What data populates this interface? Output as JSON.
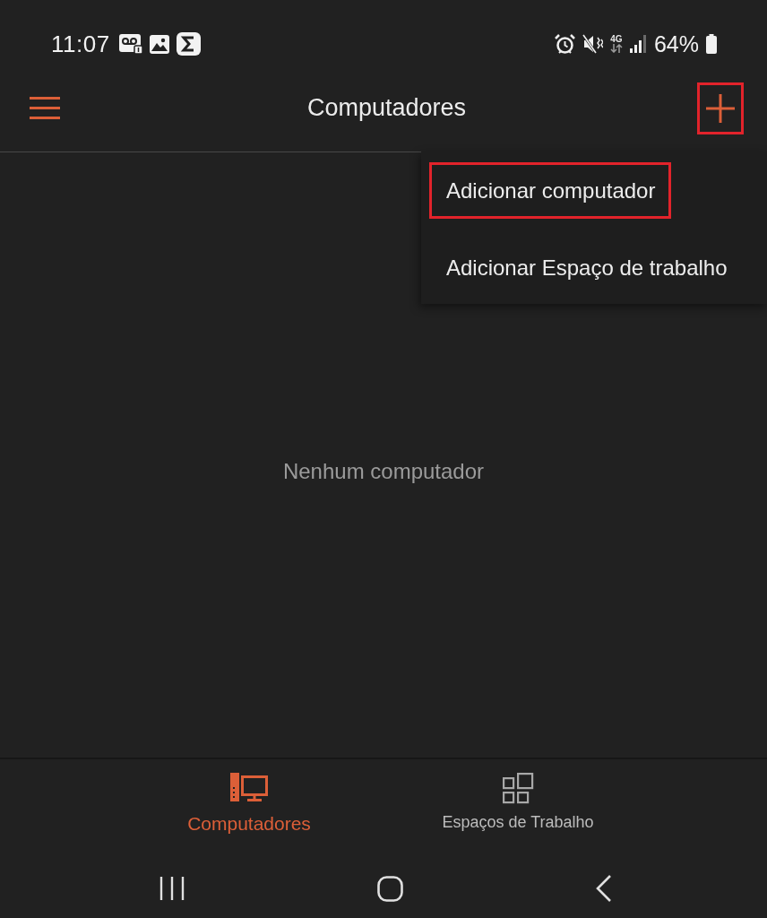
{
  "status_bar": {
    "time": "11:07",
    "network": "4G",
    "battery": "64%"
  },
  "app_bar": {
    "title": "Computadores",
    "add_button": {
      "highlighted": true
    }
  },
  "menu": {
    "items": [
      {
        "label": "Adicionar computador",
        "highlighted": true
      },
      {
        "label": "Adicionar Espaço de trabalho",
        "highlighted": false
      }
    ]
  },
  "empty_message": "Nenhum computador",
  "bottom_nav": {
    "tabs": [
      {
        "kind": "computers",
        "label": "Computadores",
        "selected": true
      },
      {
        "kind": "workspaces",
        "label": "Espaços de Trabalho",
        "selected": false
      }
    ]
  }
}
